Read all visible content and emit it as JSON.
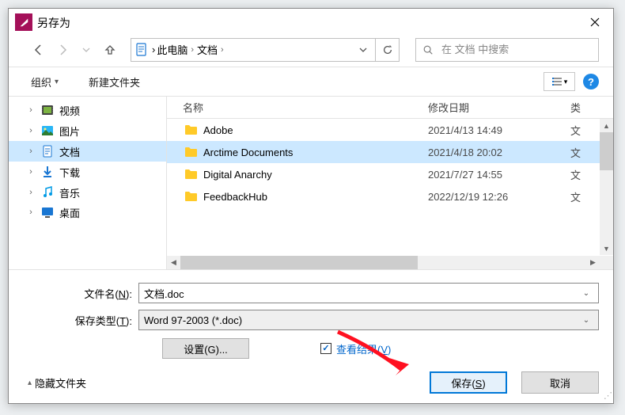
{
  "window": {
    "title": "另存为"
  },
  "breadcrumb": {
    "part1": "此电脑",
    "part2": "文档"
  },
  "search": {
    "placeholder": "在 文档 中搜索"
  },
  "toolbar": {
    "organize": "组织",
    "new_folder": "新建文件夹"
  },
  "columns": {
    "name": "名称",
    "date": "修改日期",
    "type": "类"
  },
  "sidebar": {
    "items": [
      {
        "label": "视频",
        "icon": "video"
      },
      {
        "label": "图片",
        "icon": "pictures"
      },
      {
        "label": "文档",
        "icon": "documents",
        "selected": true
      },
      {
        "label": "下载",
        "icon": "downloads"
      },
      {
        "label": "音乐",
        "icon": "music"
      },
      {
        "label": "桌面",
        "icon": "desktop",
        "partial": true
      }
    ]
  },
  "files": [
    {
      "name": "Adobe",
      "date": "2021/4/13 14:49",
      "type": "文"
    },
    {
      "name": "Arctime Documents",
      "date": "2021/4/18 20:02",
      "type": "文",
      "selected": true
    },
    {
      "name": "Digital Anarchy",
      "date": "2021/7/27 14:55",
      "type": "文"
    },
    {
      "name": "FeedbackHub",
      "date": "2022/12/19 12:26",
      "type": "文"
    }
  ],
  "form": {
    "filename_label_pre": "文件名(",
    "filename_label_u": "N",
    "filename_label_post": "):",
    "filename_value": "文档.doc",
    "savetype_label_pre": "保存类型(",
    "savetype_label_u": "T",
    "savetype_label_post": "):",
    "savetype_value": "Word 97-2003 (*.doc)"
  },
  "options": {
    "settings_label": "设置(G)...",
    "view_result_pre": "查看结果(",
    "view_result_u": "V",
    "view_result_post": ")"
  },
  "bottom": {
    "hide_folders": "隐藏文件夹",
    "save_pre": "保存(",
    "save_u": "S",
    "save_post": ")",
    "cancel": "取消"
  },
  "help": {
    "label": "?"
  }
}
